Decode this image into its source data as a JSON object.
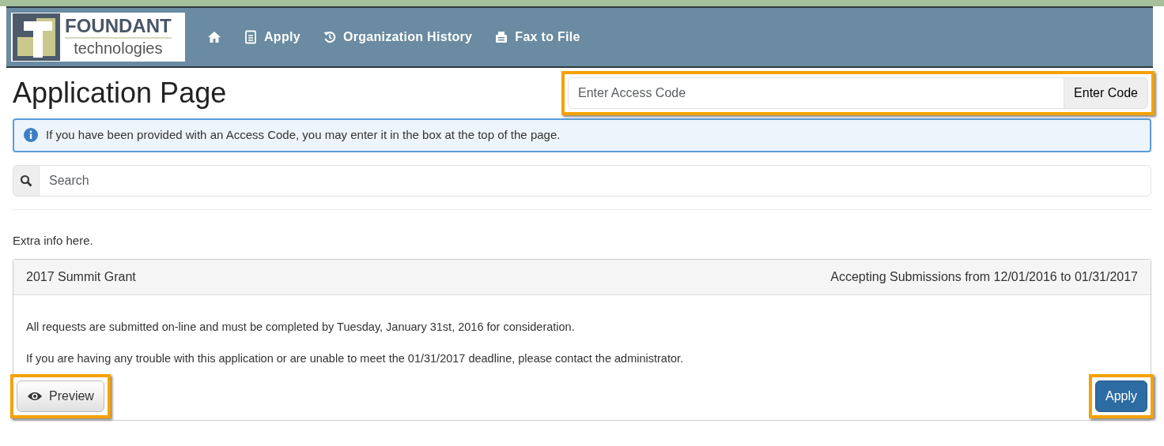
{
  "brand": {
    "name": "FOUNDANT",
    "tagline": "technologies"
  },
  "nav": [
    {
      "kind": "home"
    },
    {
      "kind": "doc",
      "label": "Apply"
    },
    {
      "kind": "history",
      "label": "Organization History"
    },
    {
      "kind": "fax",
      "label": "Fax to File"
    }
  ],
  "page_title": "Application Page",
  "access_code": {
    "placeholder": "Enter Access Code",
    "button": "Enter Code",
    "highlighted": true
  },
  "alert": "If you have been provided with an Access Code, you may enter it in the box at the top of the page.",
  "search": {
    "placeholder": "Search"
  },
  "extra_info": "Extra info here.",
  "grants": [
    {
      "title": "2017 Summit Grant",
      "window": "Accepting Submissions from 12/01/2016 to 01/31/2017",
      "paragraphs": [
        "All requests are submitted on-line and must be completed by Tuesday, January 31st, 2016 for consideration.",
        "If you are having any trouble with this application or are unable to meet the 01/31/2017 deadline, please contact the administrator."
      ],
      "preview": {
        "label": "Preview",
        "highlighted": true
      },
      "apply": {
        "label": "Apply",
        "highlighted": true
      }
    }
  ]
}
